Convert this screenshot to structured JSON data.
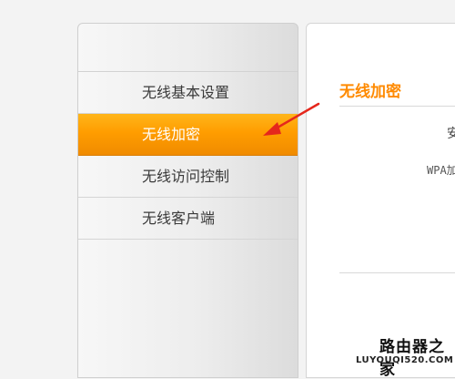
{
  "sidebar": {
    "items": [
      {
        "label": "无线基本设置",
        "active": false
      },
      {
        "label": "无线加密",
        "active": true
      },
      {
        "label": "无线访问控制",
        "active": false
      },
      {
        "label": "无线客户端",
        "active": false
      }
    ]
  },
  "content": {
    "title": "无线加密",
    "peek_line_1": "安",
    "peek_line_2": "WPA加"
  },
  "watermark": {
    "title": "路由器之家",
    "url": "LUYOUQI520.COM"
  },
  "colors": {
    "accent": "#ff9d00",
    "title": "#ff8a00",
    "arrow": "#e5271c"
  },
  "icons": [
    "red-pointer-arrow-icon"
  ]
}
